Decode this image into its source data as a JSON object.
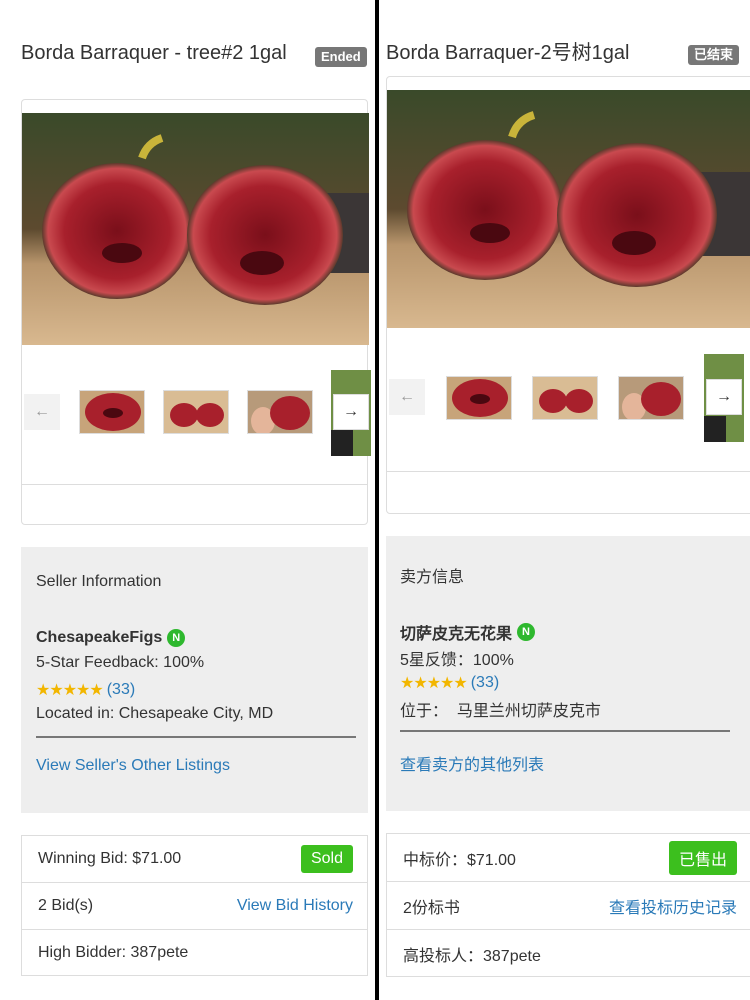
{
  "left": {
    "title": "Borda Barraquer - tree#2 1gal",
    "status_badge": "Ended",
    "seller": {
      "heading": "Seller Information",
      "name": "ChesapeakeFigs",
      "new_badge": "N",
      "feedback": "5-Star Feedback: 100%",
      "stars": "★★★★★",
      "feedback_count": "(33)",
      "location": "Located in: Chesapeake City, MD",
      "other_listings": "View Seller's Other Listings"
    },
    "bids": {
      "winning_bid": "Winning Bid: $71.00",
      "sold_label": "Sold",
      "bid_count": "2 Bid(s)",
      "bid_history": "View Bid History",
      "high_bidder": "High Bidder: 387pete"
    }
  },
  "right": {
    "title": "Borda Barraquer-2号树1gal",
    "status_badge": "已结束",
    "seller": {
      "heading": "卖方信息",
      "name": "切萨皮克无花果",
      "new_badge": "N",
      "feedback": "5星反馈：100%",
      "stars": "★★★★★",
      "feedback_count": "(33)",
      "location": "位于：  马里兰州切萨皮克市",
      "other_listings": "查看卖方的其他列表"
    },
    "bids": {
      "winning_bid": "中标价：$71.00",
      "sold_label": "已售出",
      "bid_count": "2份标书",
      "bid_history": "查看投标历史记录",
      "high_bidder": "高投标人：387pete"
    }
  },
  "icons": {
    "prev": "arrow-left-icon",
    "next": "arrow-right-icon"
  },
  "colors": {
    "link": "#2a7ab8",
    "sold": "#3cbf1e",
    "badge": "#777777",
    "seller_bg": "#eeeeee",
    "new_badge": "#2eb82e",
    "stars": "#f2b600"
  }
}
